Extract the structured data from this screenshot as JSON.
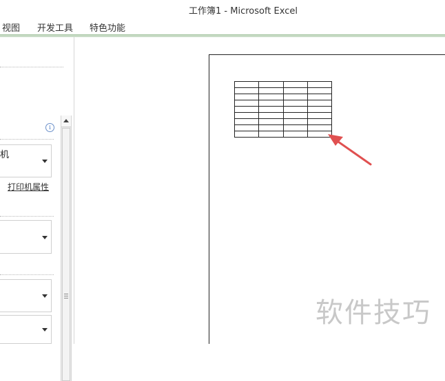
{
  "window": {
    "title": "工作簿1 - Microsoft Excel"
  },
  "ribbon": {
    "tabs": [
      {
        "label": "视图"
      },
      {
        "label": "开发工具"
      },
      {
        "label": "特色功能"
      }
    ]
  },
  "print_panel": {
    "printer_dropdown": {
      "label": "机"
    },
    "printer_properties_link": "打印机属性",
    "info_icon": "info-icon"
  },
  "watermark": {
    "text": "软件技巧"
  },
  "colors": {
    "ribbon_accent": "#9fc19b",
    "arrow": "#e05050"
  }
}
